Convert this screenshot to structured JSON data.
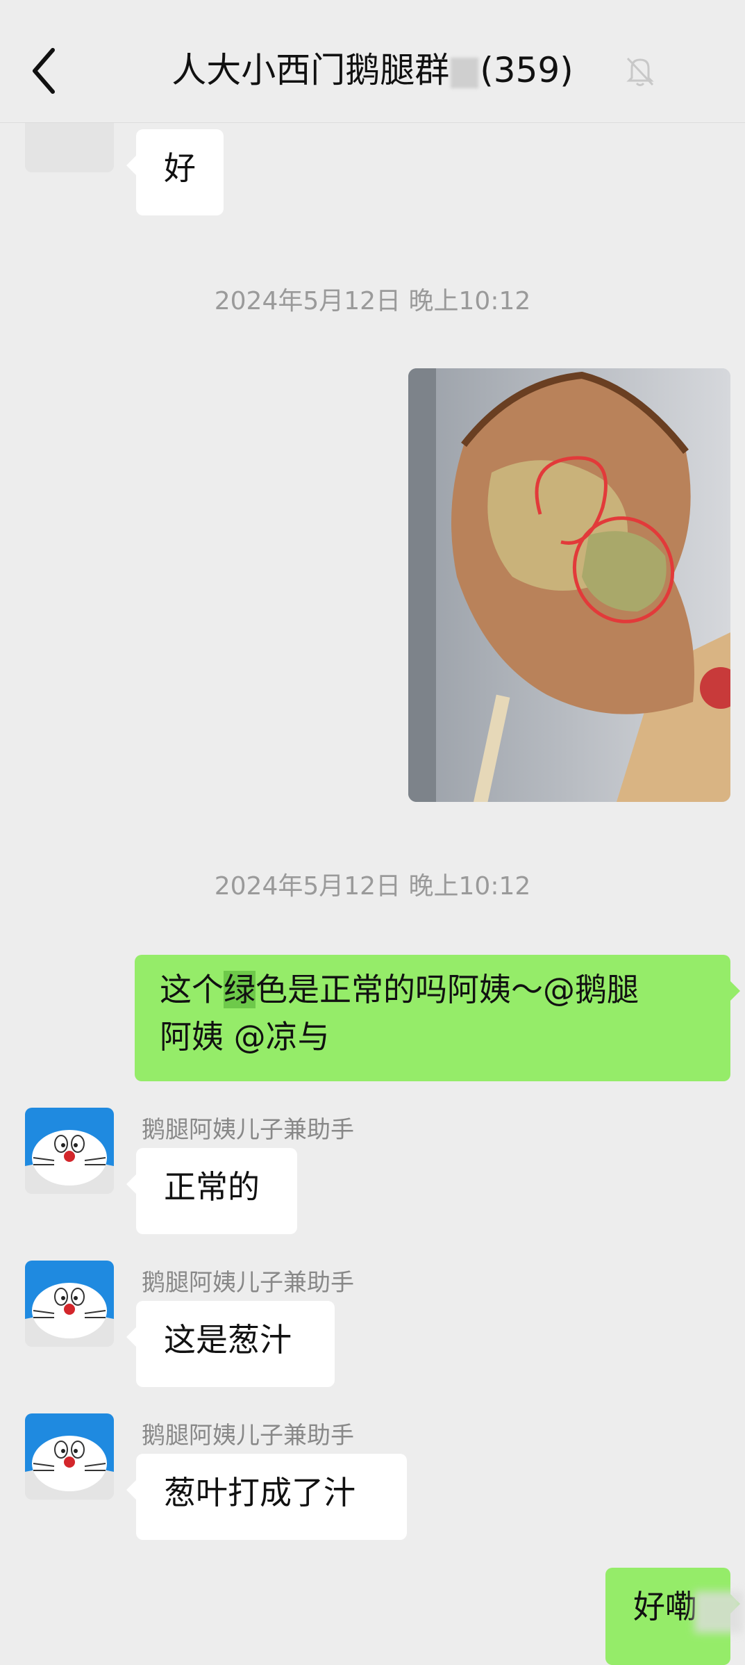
{
  "header": {
    "back_icon": "chevron-left-icon",
    "title_prefix": "人大小西门鹅腿群",
    "title_suffix": "(359)",
    "mute_icon": "bell-off-icon"
  },
  "messages": {
    "m1": {
      "text": "好"
    },
    "time1": "2024年5月12日 晚上10:12",
    "photo": {
      "type": "image",
      "description_icon": "photo-goose-leg"
    },
    "time2": "2024年5月12日 晚上10:12",
    "m2": {
      "part1": "这个",
      "highlight": "绿",
      "part2": "色是正常的吗阿姨～@鹅腿",
      "line2": "阿姨 @凉与"
    },
    "m3": {
      "sender": "鹅腿阿姨儿子兼助手",
      "text": "正常的"
    },
    "m4": {
      "sender": "鹅腿阿姨儿子兼助手",
      "text": "这是葱汁"
    },
    "m5": {
      "sender": "鹅腿阿姨儿子兼助手",
      "text": "葱叶打成了汁"
    },
    "m6": {
      "text": "好嘞"
    }
  },
  "colors": {
    "background": "#ededed",
    "outgoing_bubble": "#95ec69",
    "incoming_bubble": "#ffffff",
    "highlight": "#6ec94a"
  }
}
